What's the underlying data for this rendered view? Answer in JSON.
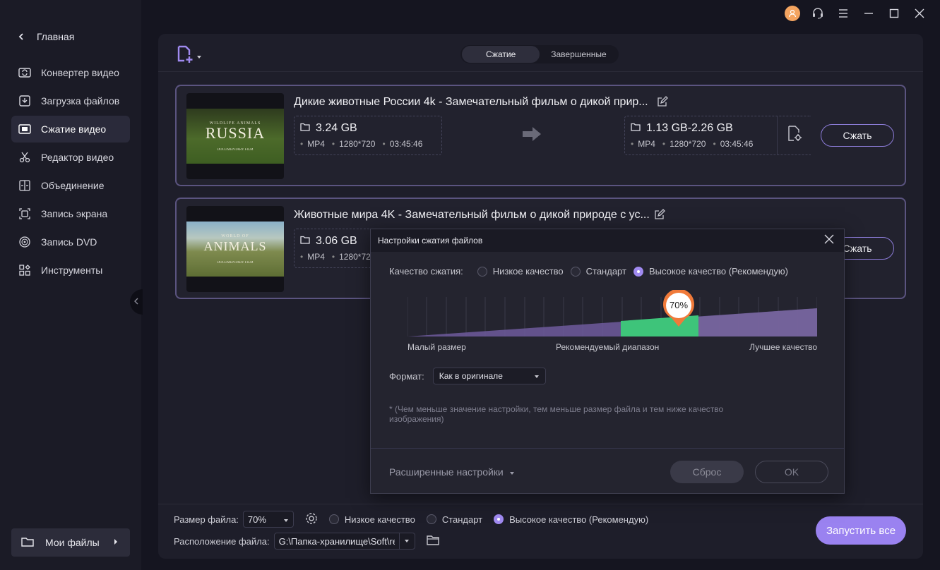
{
  "sidebar": {
    "home_label": "Главная",
    "items": [
      {
        "label": "Конвертер видео",
        "icon": "convert-icon"
      },
      {
        "label": "Загрузка файлов",
        "icon": "download-icon"
      },
      {
        "label": "Сжатие видео",
        "icon": "compress-icon",
        "active": true
      },
      {
        "label": "Редактор видео",
        "icon": "scissors-icon"
      },
      {
        "label": "Объединение",
        "icon": "merge-icon"
      },
      {
        "label": "Запись экрана",
        "icon": "screen-record-icon"
      },
      {
        "label": "Запись DVD",
        "icon": "dvd-icon"
      },
      {
        "label": "Инструменты",
        "icon": "tools-icon"
      }
    ],
    "my_files_label": "Мои файлы"
  },
  "tabs": {
    "compress": "Сжатие",
    "finished": "Завершенные"
  },
  "files": [
    {
      "title": "Дикие животные России 4k - Замечательный фильм о дикой прир...",
      "thumb_small": "WILDLIFE ANIMALS",
      "thumb_big": "RUSSIA",
      "thumb_sub": "DOCUMENTARY FILM",
      "source": {
        "size": "3.24 GB",
        "format": "MP4",
        "resolution": "1280*720",
        "duration": "03:45:46"
      },
      "target": {
        "size": "1.13 GB-2.26 GB",
        "format": "MP4",
        "resolution": "1280*720",
        "duration": "03:45:46"
      },
      "button": "Сжать"
    },
    {
      "title": "Животные мира 4K - Замечательный фильм о дикой природе с ус...",
      "thumb_small": "WORLD OF",
      "thumb_big": "ANIMALS",
      "thumb_sub": "DOCUMENTARY FILM",
      "source": {
        "size": "3.06 GB",
        "format": "MP4",
        "resolution": "1280*72"
      },
      "button": "Сжать"
    }
  ],
  "bottom": {
    "file_size_label": "Размер файла:",
    "file_size_value": "70%",
    "quality_low": "Низкое качество",
    "quality_std": "Стандарт",
    "quality_high": "Высокое качество (Рекомендую)",
    "location_label": "Расположение файла:",
    "location_value": "G:\\Папка-хранилище\\Soft\\rel",
    "start_all": "Запустить все"
  },
  "dialog": {
    "title": "Настройки сжатия файлов",
    "quality_label": "Качество сжатия:",
    "options": [
      "Низкое качество",
      "Стандарт",
      "Высокое качество (Рекомендую)"
    ],
    "selected_option": 2,
    "slider_value": 70,
    "slider_text": "70%",
    "label_small": "Малый размер",
    "label_recommended": "Рекомендуемый диапазон",
    "label_best": "Лучшее качество",
    "format_label": "Формат:",
    "format_value": "Как в оригинале",
    "note": "* (Чем меньше значение настройки, тем меньше размер файла и тем ниже качество изображения)",
    "advanced": "Расширенные настройки",
    "reset": "Сброс",
    "ok": "OK"
  },
  "colors": {
    "accent": "#9a82f0",
    "recommended": "#3ec47a",
    "slider_marker": "#f07a3a"
  }
}
